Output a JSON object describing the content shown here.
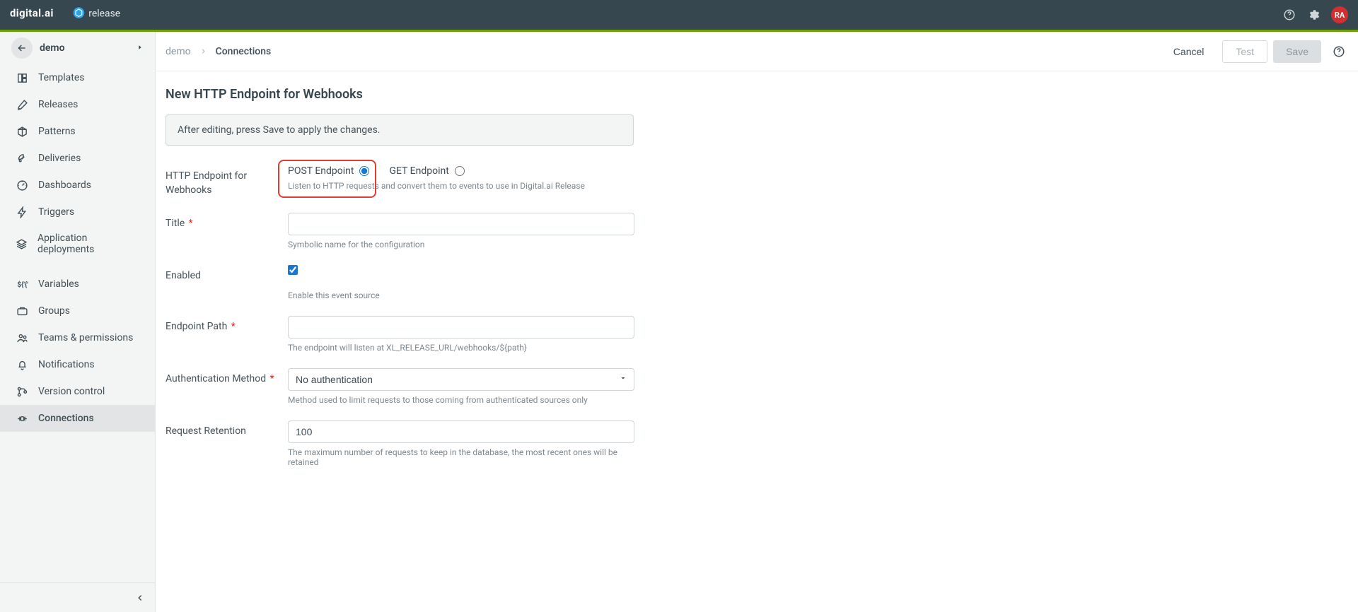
{
  "topbar": {
    "avatar_initials": "RA"
  },
  "sidebar": {
    "header_title": "demo",
    "items": [
      {
        "label": "Templates"
      },
      {
        "label": "Releases"
      },
      {
        "label": "Patterns"
      },
      {
        "label": "Deliveries"
      },
      {
        "label": "Dashboards"
      },
      {
        "label": "Triggers"
      },
      {
        "label": "Application deployments"
      },
      {
        "label": "Variables"
      },
      {
        "label": "Groups"
      },
      {
        "label": "Teams & permissions"
      },
      {
        "label": "Notifications"
      },
      {
        "label": "Version control"
      },
      {
        "label": "Connections"
      }
    ]
  },
  "breadcrumb": {
    "root": "demo",
    "current": "Connections"
  },
  "header_actions": {
    "cancel": "Cancel",
    "test": "Test",
    "save": "Save"
  },
  "page_title": "New HTTP Endpoint for Webhooks",
  "info_box": "After editing, press Save to apply the changes.",
  "form": {
    "endpoint_type": {
      "label": "HTTP Endpoint for Webhooks",
      "post_label": "POST Endpoint",
      "get_label": "GET Endpoint",
      "help": "Listen to HTTP requests and convert them to events to use in Digital.ai Release"
    },
    "title": {
      "label": "Title",
      "value": "",
      "help": "Symbolic name for the configuration"
    },
    "enabled": {
      "label": "Enabled",
      "checked": true,
      "help": "Enable this event source"
    },
    "endpoint_path": {
      "label": "Endpoint Path",
      "value": "",
      "help": "The endpoint will listen at XL_RELEASE_URL/webhooks/${path}"
    },
    "auth_method": {
      "label": "Authentication Method",
      "value": "No authentication",
      "help": "Method used to limit requests to those coming from authenticated sources only"
    },
    "retention": {
      "label": "Request Retention",
      "value": "100",
      "help": "The maximum number of requests to keep in the database, the most recent ones will be retained"
    }
  }
}
